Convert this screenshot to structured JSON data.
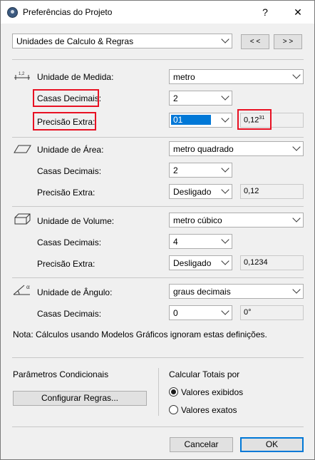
{
  "window": {
    "title": "Preferências do Projeto",
    "help": "?",
    "close": "✕"
  },
  "header": {
    "category": "Unidades de Calculo & Regras",
    "prev": "< <",
    "next": "> >"
  },
  "medida": {
    "label": "Unidade de Medida:",
    "unit": "metro",
    "decimals_label": "Casas Decimais:",
    "decimals": "2",
    "precision_label": "Precisão Extra:",
    "precision": "01",
    "preview": "0,12",
    "preview_sup": "31"
  },
  "area": {
    "label": "Unidade de Área:",
    "unit": "metro quadrado",
    "decimals_label": "Casas Decimais:",
    "decimals": "2",
    "precision_label": "Precisão Extra:",
    "precision": "Desligado",
    "preview": "0,12"
  },
  "volume": {
    "label": "Unidade de Volume:",
    "unit": "metro cúbico",
    "decimals_label": "Casas Decimais:",
    "decimals": "4",
    "precision_label": "Precisão Extra:",
    "precision": "Desligado",
    "preview": "0,1234"
  },
  "angulo": {
    "label": "Unidade de Ângulo:",
    "unit": "graus decimais",
    "decimals_label": "Casas Decimais:",
    "decimals": "0",
    "preview": "0°"
  },
  "note": "Nota: Cálculos usando Modelos Gráficos ignoram estas definições.",
  "conditional": {
    "title": "Parâmetros Condicionais",
    "button": "Configurar Regras..."
  },
  "totals": {
    "title": "Calcular Totais por",
    "option1": "Valores exibidos",
    "option2": "Valores exatos",
    "selected": "option1"
  },
  "footer": {
    "cancel": "Cancelar",
    "ok": "OK"
  },
  "colors": {
    "highlight": "#e81123",
    "selection": "#0078d7"
  }
}
